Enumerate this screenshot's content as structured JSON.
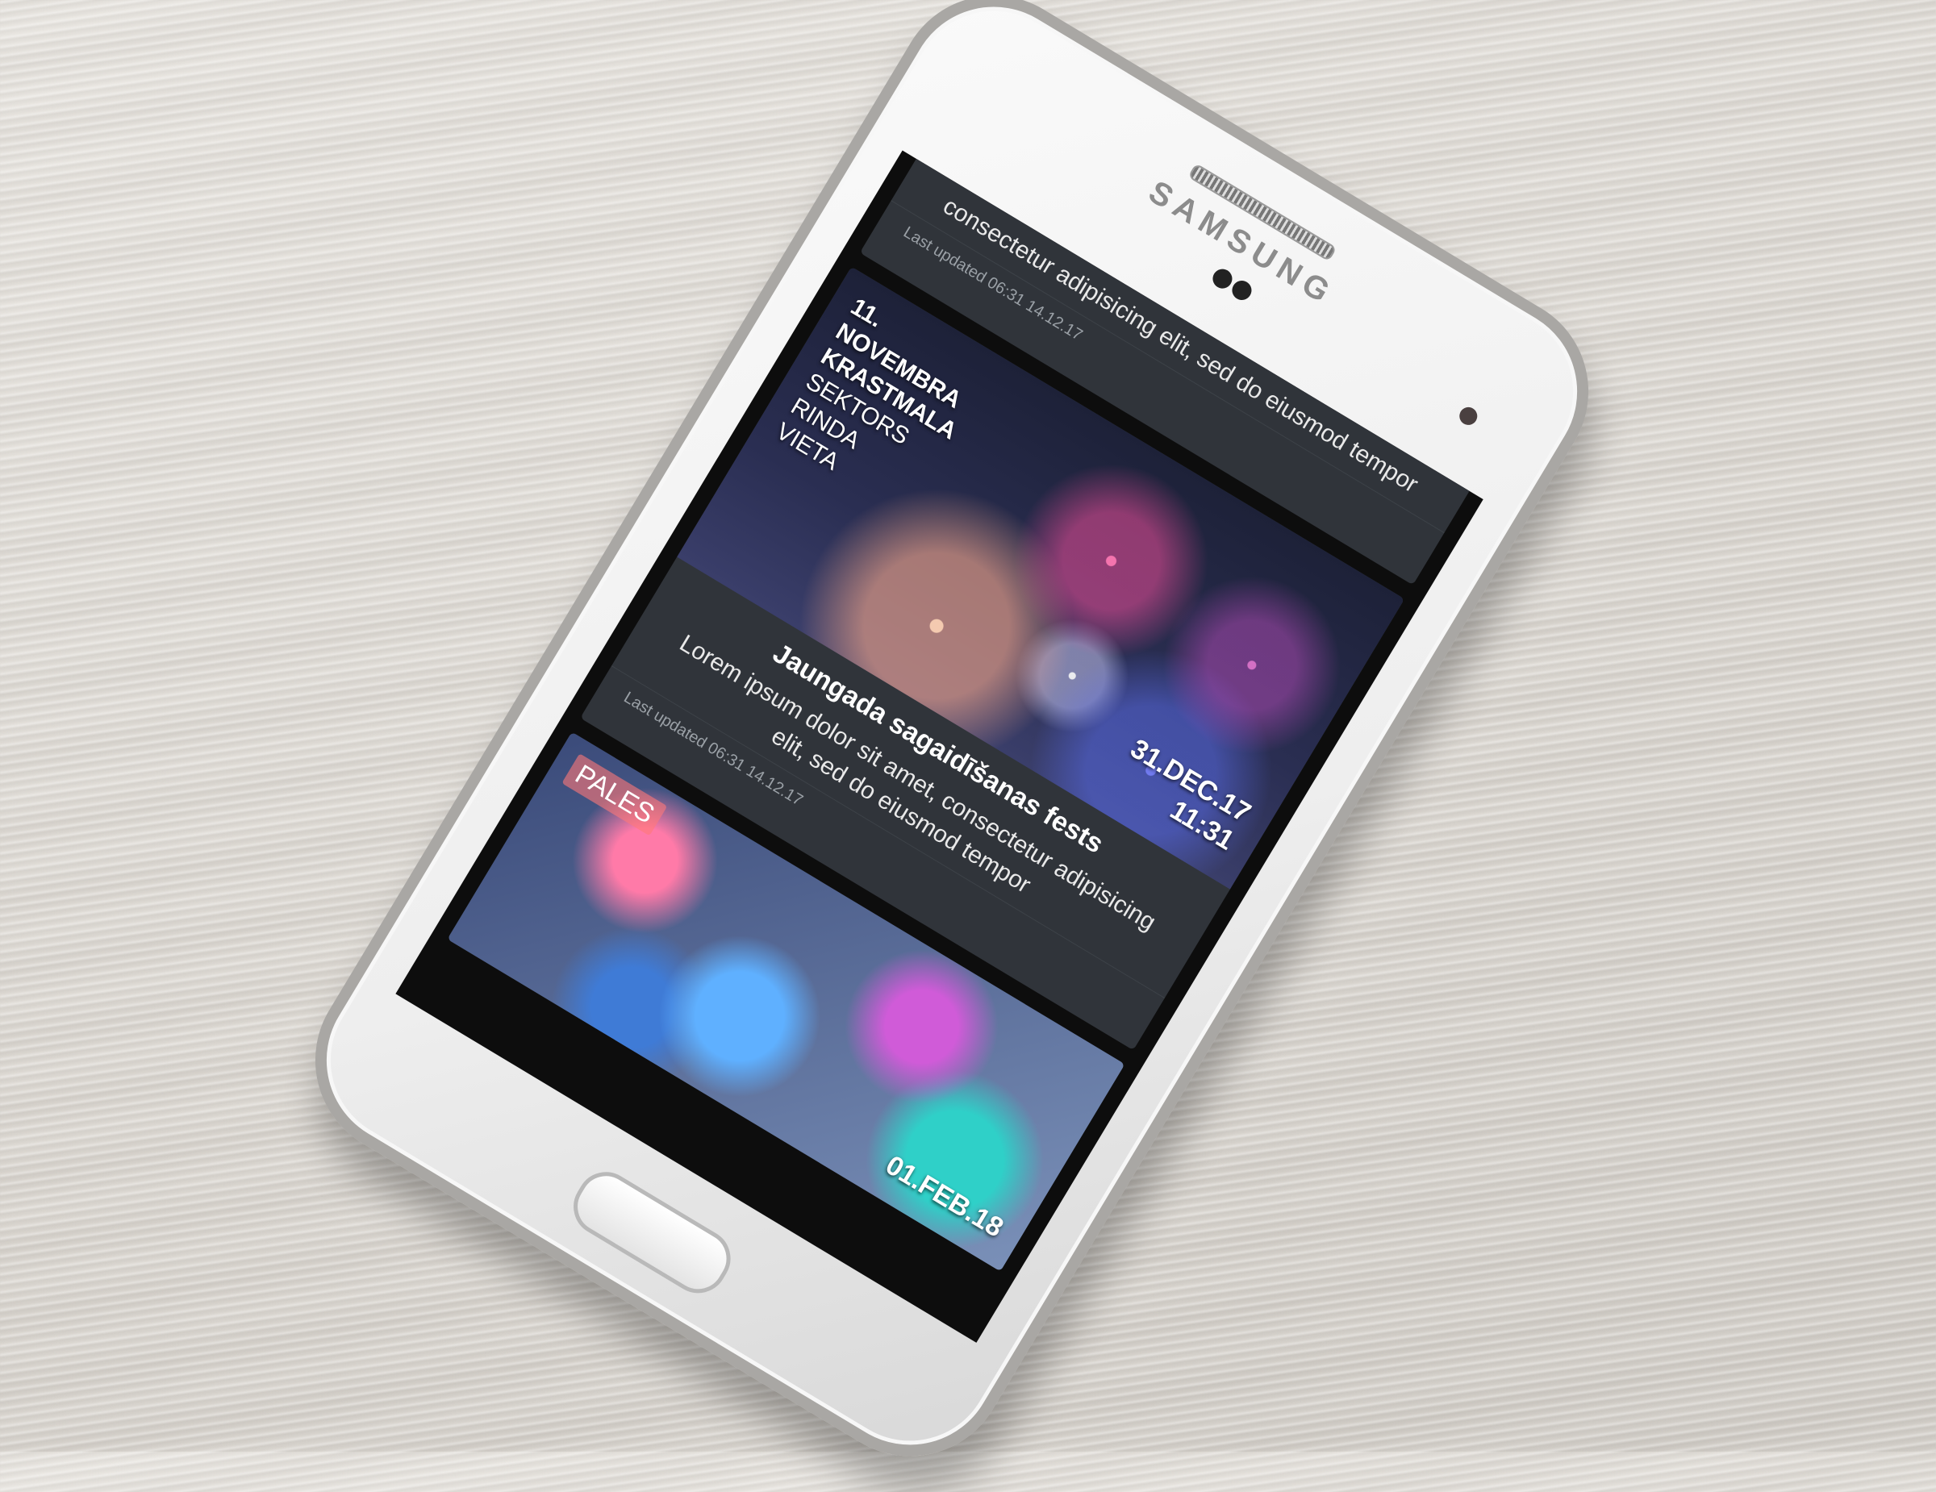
{
  "device": {
    "brand": "SAMSUNG"
  },
  "feed": {
    "cards": [
      {
        "type": "text-only",
        "description": "consectetur adipisicing elit, sed do eiusmod tempor",
        "updated": "Last updated 06:31 14.12.17"
      },
      {
        "type": "event",
        "overlay": {
          "lines": [
            "11.",
            "NOVEMBRA",
            "KRASTMALA",
            "SEKTORS",
            "RINDA",
            "VIETA"
          ],
          "date": "31.DEC.17",
          "time": "11:31"
        },
        "title": "Jaungada sagaidīšanas fests",
        "description": "Lorem ipsum dolor sit amet, consectetur adipisicing elit, sed do eiusmod tempor",
        "updated": "Last updated 06:31 14.12.17"
      },
      {
        "type": "event-partial",
        "label": "PALES",
        "date": "01.FEB.18"
      }
    ]
  }
}
